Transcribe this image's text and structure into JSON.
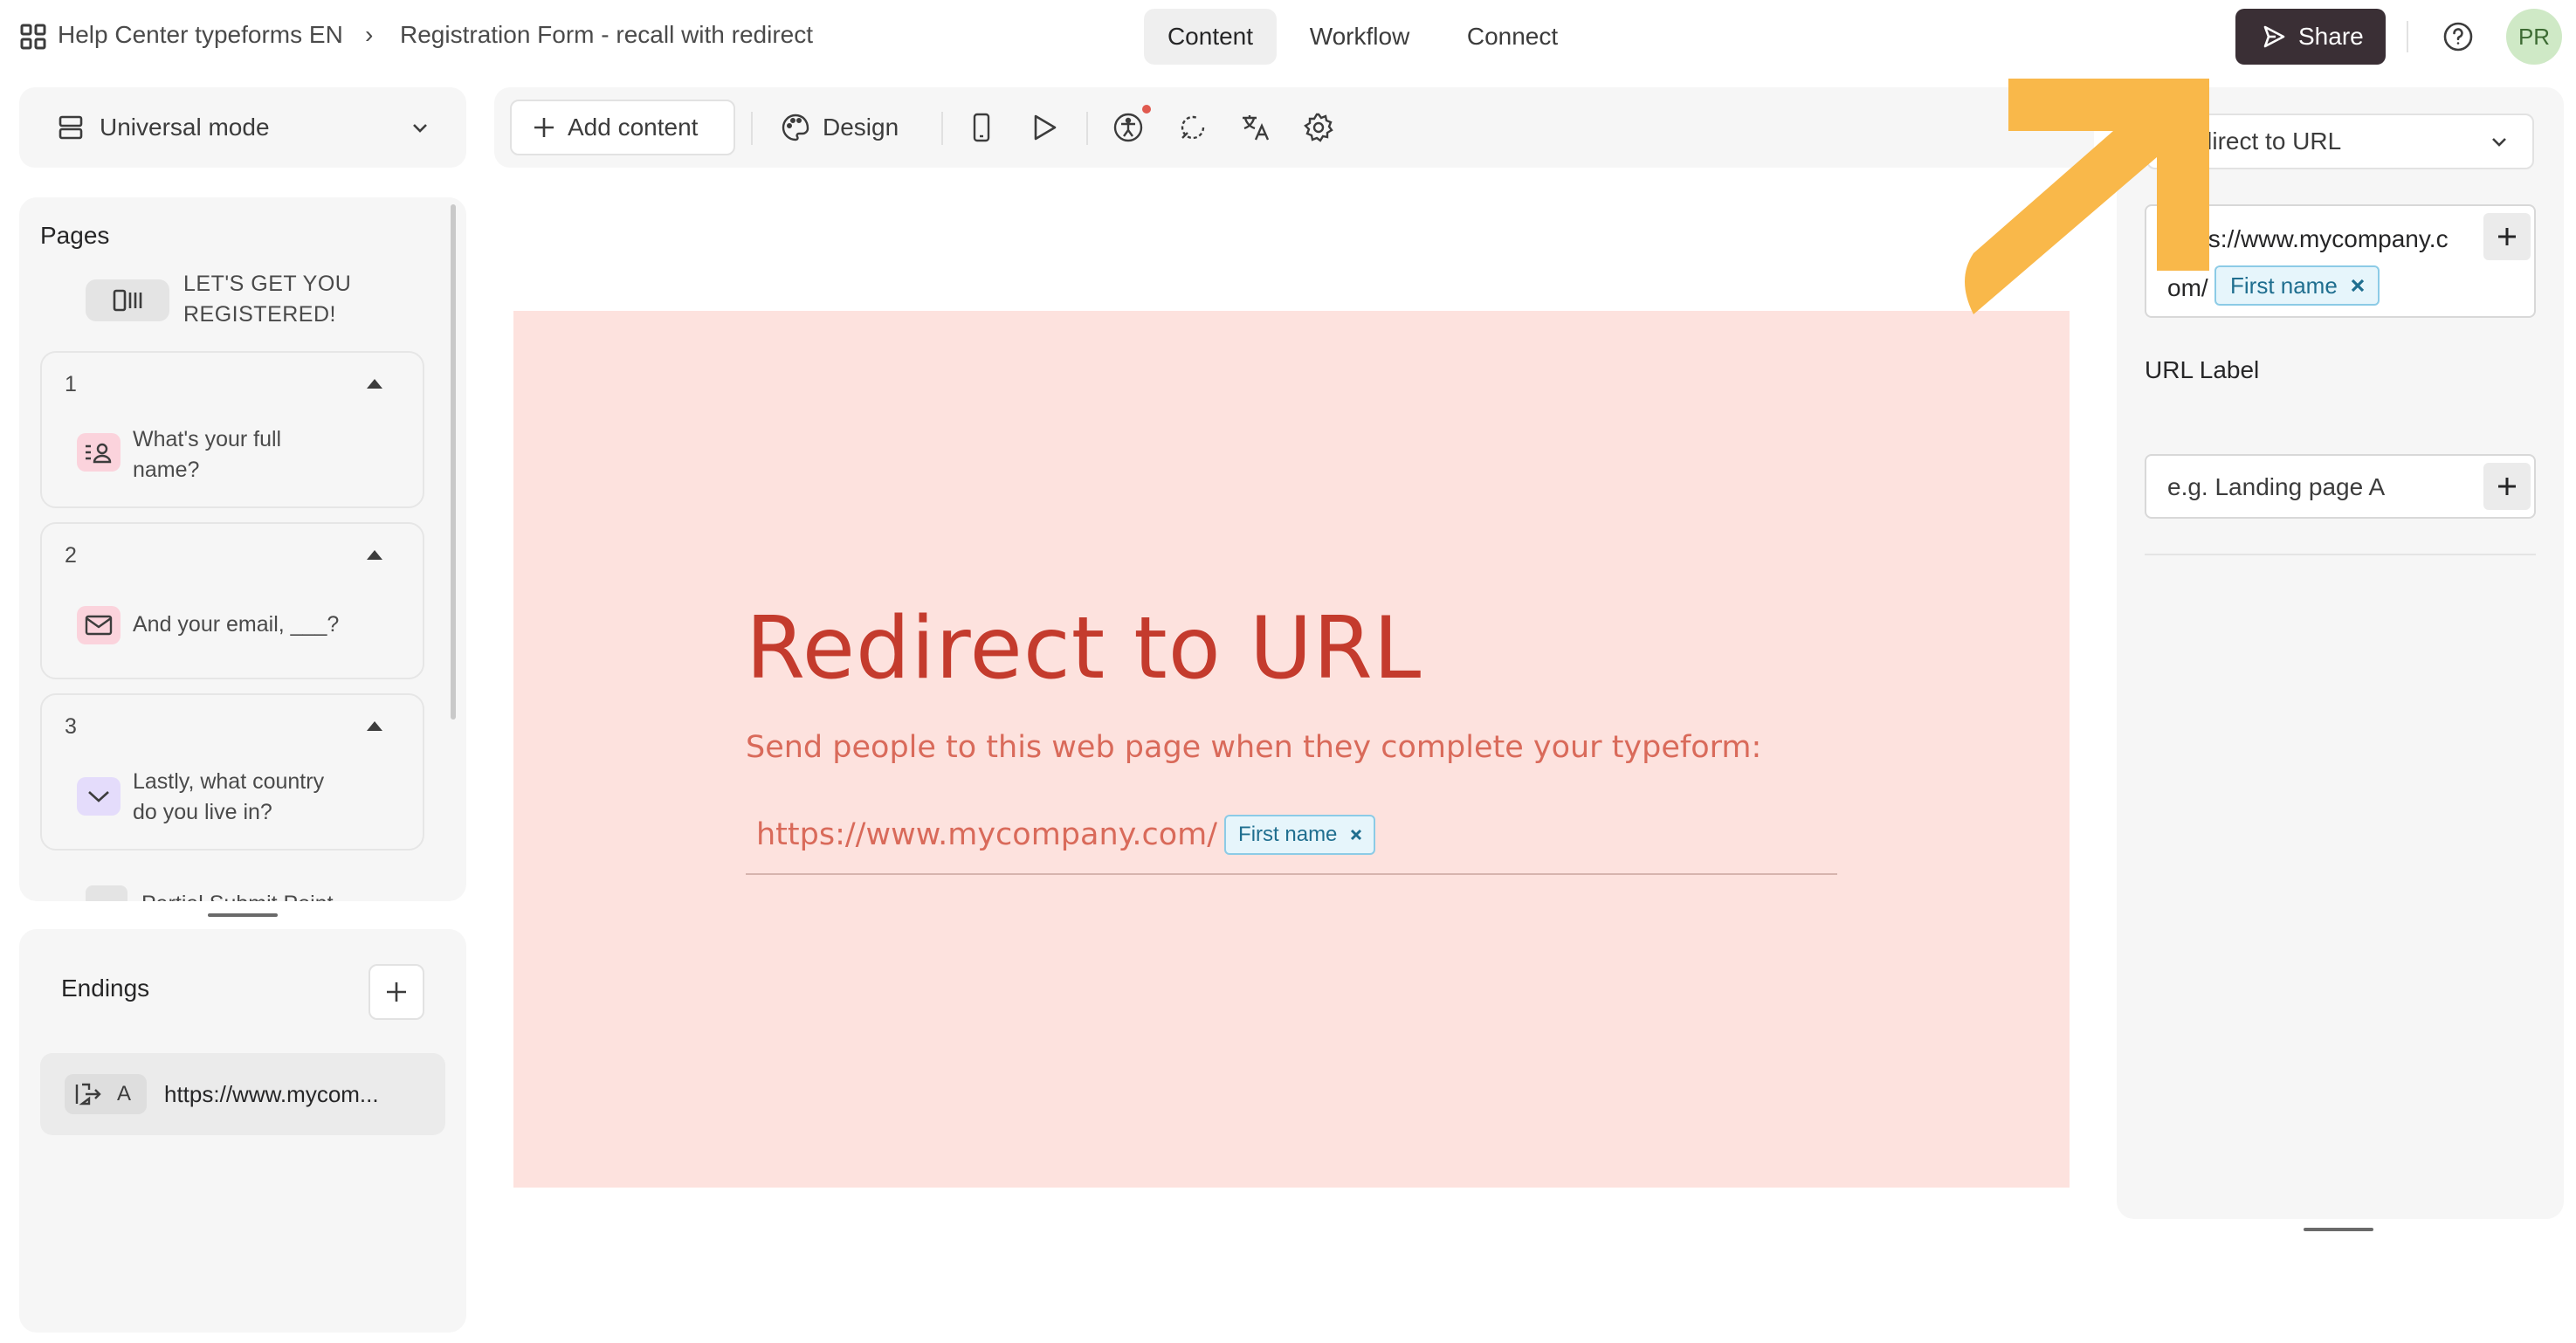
{
  "header": {
    "workspace": "Help Center typeforms EN",
    "form_title": "Registration Form - recall with redirect",
    "tabs": [
      "Content",
      "Workflow",
      "Connect"
    ],
    "active_tab": "Content",
    "share_label": "Share",
    "avatar_initials": "PR"
  },
  "left": {
    "mode_label": "Universal mode",
    "pages_title": "Pages",
    "welcome_line1": "LET'S GET YOU",
    "welcome_line2": "REGISTERED!",
    "questions": [
      {
        "number": "1",
        "line1": "What's your full",
        "line2": "name?",
        "icon": "contact-info-icon",
        "icon_bg": "#fbd3dc"
      },
      {
        "number": "2",
        "line1": "And your email, ___?",
        "line2": "",
        "icon": "envelope-icon",
        "icon_bg": "#fbd3dc"
      },
      {
        "number": "3",
        "line1": "Lastly, what country",
        "line2": "do you live in?",
        "icon": "dropdown-chevron-icon",
        "icon_bg": "#e4dcfb"
      }
    ],
    "partial_item": "Partial Submit Point",
    "endings_title": "Endings",
    "ending_letter": "A",
    "ending_url": "https://www.mycom..."
  },
  "toolbar": {
    "add_content": "Add content",
    "design": "Design"
  },
  "canvas": {
    "title": "Redirect to URL",
    "subtitle": "Send people to this web page when they complete your typeform:",
    "url": "https://www.mycompany.com/",
    "recall_chip": "First name",
    "bg_color": "#fde2de",
    "text_color": "#c43b2d"
  },
  "right": {
    "ending_type": "Redirect to URL",
    "url_value_line1": "https://www.mycompany.c",
    "url_value_line2": "om/",
    "recall_chip": "First name",
    "url_label_title": "URL Label",
    "url_label_placeholder": "e.g. Landing page A"
  },
  "overlay": {
    "arrow_color": "#f9b84a"
  }
}
